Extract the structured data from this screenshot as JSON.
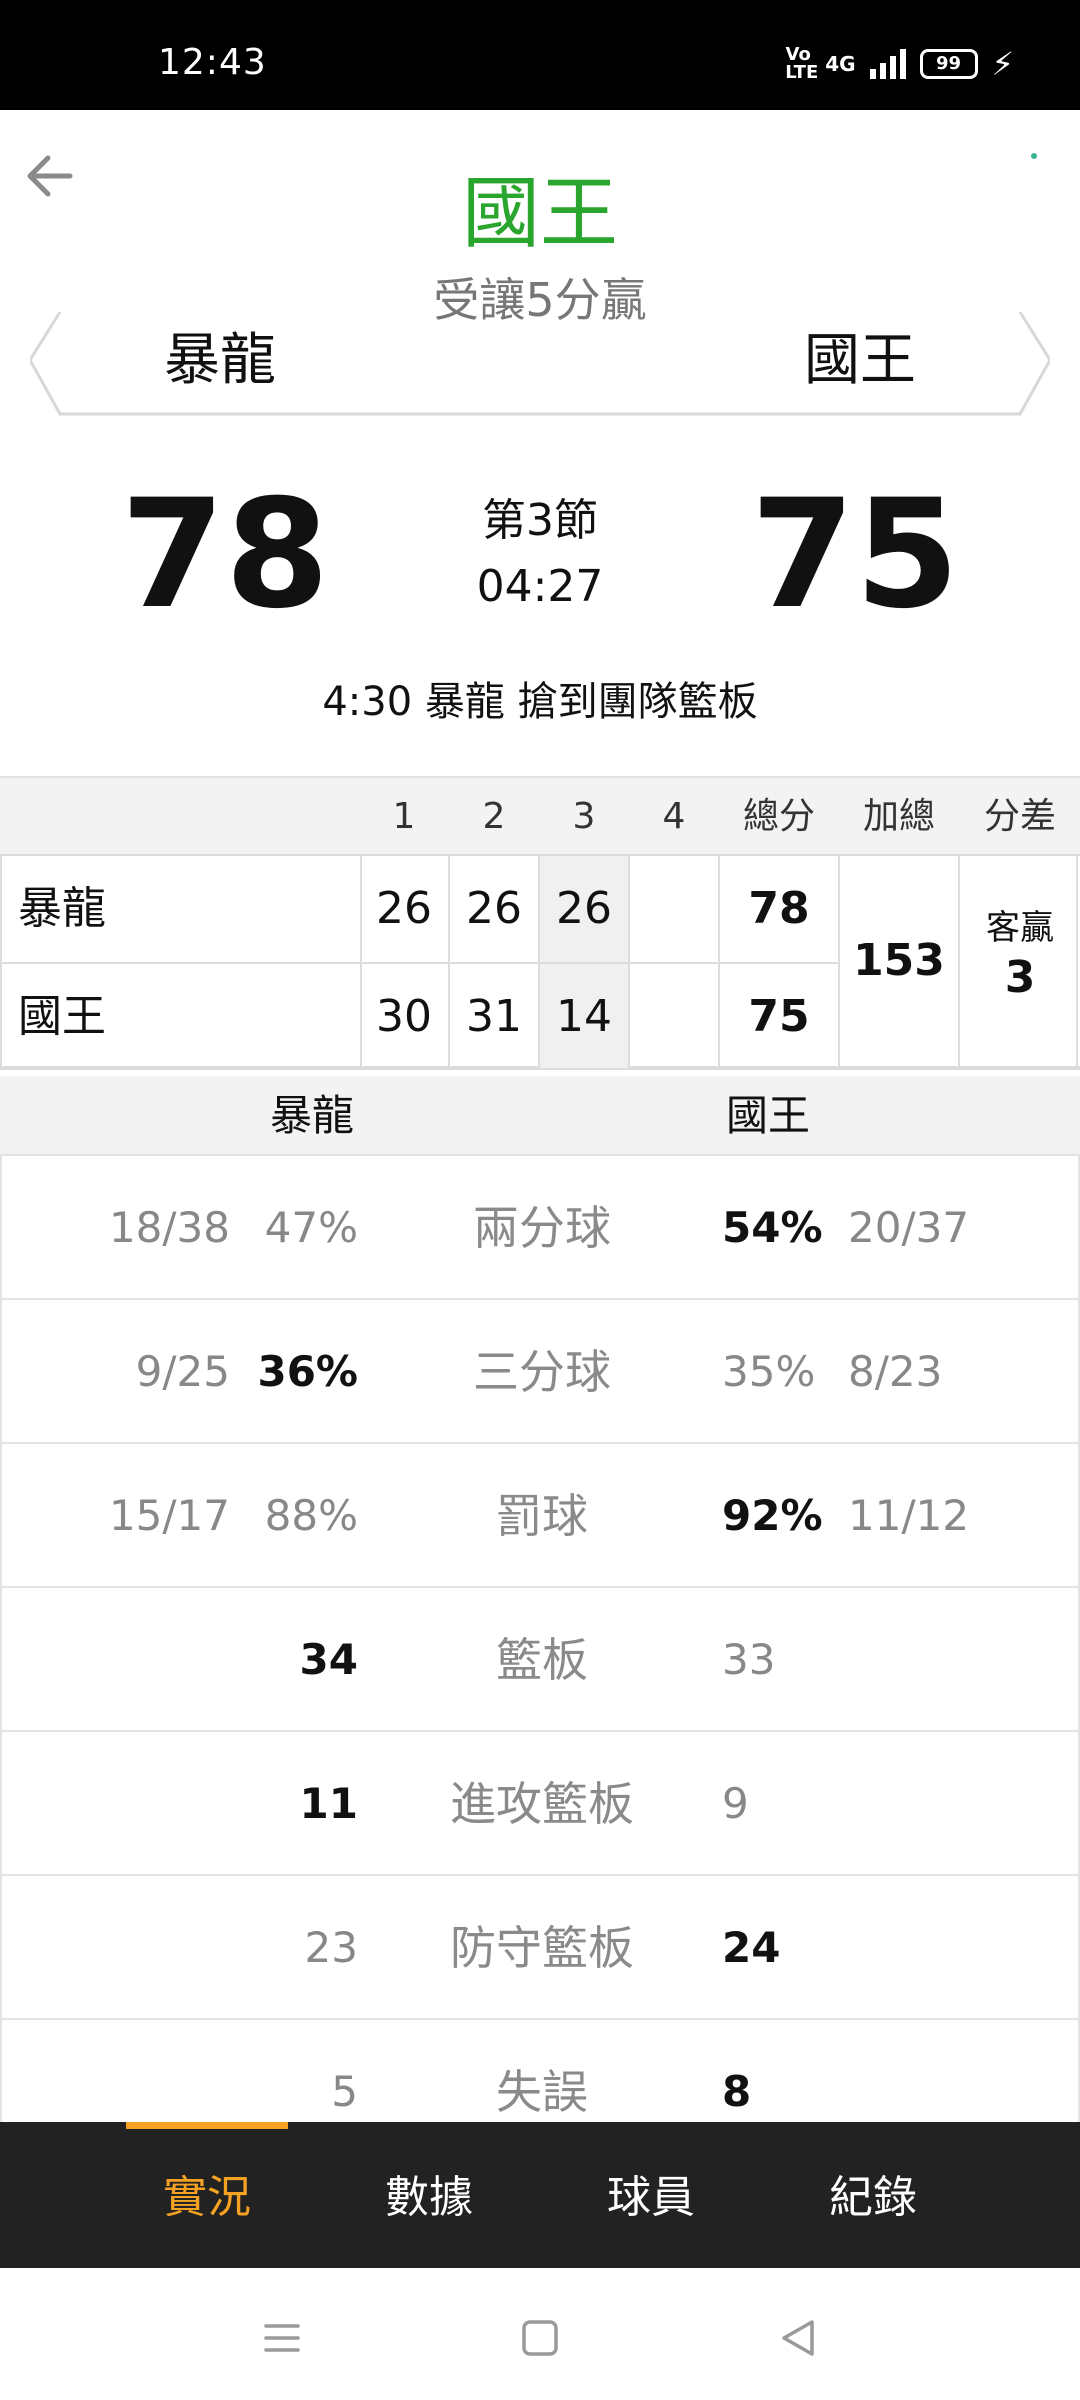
{
  "status_bar": {
    "time": "12:43",
    "volte": "Vo LTE",
    "network": "4G",
    "battery": "99",
    "icons": [
      "volte-icon",
      "signal-icon",
      "battery-icon",
      "charging-icon"
    ]
  },
  "header": {
    "back_icon": "back-arrow-icon",
    "winner": "國王",
    "handicap_result": "受讓5分贏",
    "away_team": "暴龍",
    "home_team": "國王"
  },
  "scoreboard": {
    "away_score": "78",
    "home_score": "75",
    "period": "第3節",
    "clock": "04:27",
    "last_play": "4:30 暴龍  搶到團隊籃板"
  },
  "box_score": {
    "headers": [
      "1",
      "2",
      "3",
      "4",
      "總分",
      "加總",
      "分差"
    ],
    "rows": [
      {
        "team": "暴龍",
        "q1": "26",
        "q2": "26",
        "q3": "26",
        "q4": "",
        "total": "78"
      },
      {
        "team": "國王",
        "q1": "30",
        "q2": "31",
        "q3": "14",
        "q4": "",
        "total": "75"
      }
    ],
    "combined_total": "153",
    "margin_label": "客贏",
    "margin_value": "3",
    "current_quarter_highlight_color": "#f0f0f0"
  },
  "team_stats": {
    "away_team": "暴龍",
    "home_team": "國王",
    "rows": [
      {
        "label": "兩分球",
        "away_ratio": "18/38",
        "away_value": "47%",
        "home_value": "54%",
        "home_ratio": "20/37",
        "leader": "home"
      },
      {
        "label": "三分球",
        "away_ratio": "9/25",
        "away_value": "36%",
        "home_value": "35%",
        "home_ratio": "8/23",
        "leader": "away"
      },
      {
        "label": "罰球",
        "away_ratio": "15/17",
        "away_value": "88%",
        "home_value": "92%",
        "home_ratio": "11/12",
        "leader": "home"
      },
      {
        "label": "籃板",
        "away_ratio": "",
        "away_value": "34",
        "home_value": "33",
        "home_ratio": "",
        "leader": "away"
      },
      {
        "label": "進攻籃板",
        "away_ratio": "",
        "away_value": "11",
        "home_value": "9",
        "home_ratio": "",
        "leader": "away"
      },
      {
        "label": "防守籃板",
        "away_ratio": "",
        "away_value": "23",
        "home_value": "24",
        "home_ratio": "",
        "leader": "home"
      },
      {
        "label": "失誤",
        "away_ratio": "",
        "away_value": "5",
        "home_value": "8",
        "home_ratio": "",
        "leader": "home"
      }
    ]
  },
  "tabs": {
    "items": [
      {
        "label": "實況",
        "active": true
      },
      {
        "label": "數據",
        "active": false
      },
      {
        "label": "球員",
        "active": false
      },
      {
        "label": "紀錄",
        "active": false
      }
    ],
    "accent_color": "#f5a223"
  },
  "nav_bar": {
    "icons": [
      "menu-icon",
      "home-square-icon",
      "back-triangle-icon"
    ]
  },
  "colors": {
    "winner_green": "#2aa52e",
    "tab_bar_bg": "#222222",
    "status_bar_bg": "#000000"
  }
}
